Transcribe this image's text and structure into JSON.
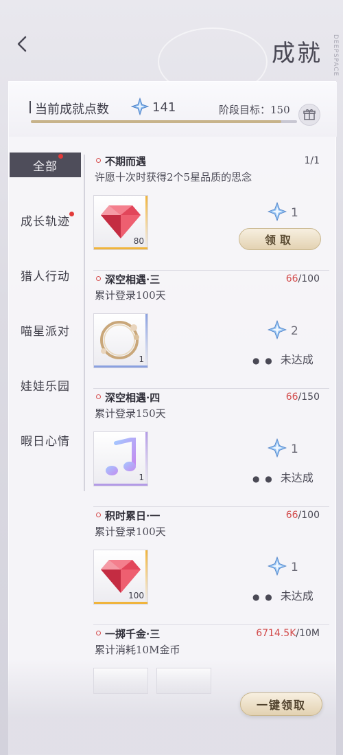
{
  "page": {
    "title": "成就"
  },
  "header": {
    "label": "当前成就点数",
    "points": "141",
    "goal": "阶段目标：150",
    "progress": 0.94
  },
  "tabs": [
    {
      "label": "全部",
      "active": true,
      "badge": true
    },
    {
      "label": "成长轨迹",
      "active": false,
      "badge": true
    },
    {
      "label": "猎人行动",
      "active": false,
      "badge": false
    },
    {
      "label": "喵星派对",
      "active": false,
      "badge": false
    },
    {
      "label": "娃娃乐园",
      "active": false,
      "badge": false
    },
    {
      "label": "暇日心情",
      "active": false,
      "badge": false
    }
  ],
  "achievements": [
    {
      "title": "不期而遇",
      "progress_current": "1",
      "progress_total": "/1",
      "completed": true,
      "desc": "许愿十次时获得2个5星品质的思念",
      "item": {
        "icon": "gem-icon",
        "count": "80",
        "color": "#f0b43c"
      },
      "reward": "1",
      "status": "领取"
    },
    {
      "title": "深空相遇·三",
      "progress_current": "66",
      "progress_total": "/100",
      "completed": false,
      "desc": "累计登录100天",
      "item": {
        "icon": "frame-icon",
        "count": "1",
        "color": "#8aa0e0"
      },
      "reward": "2",
      "status": "未达成"
    },
    {
      "title": "深空相遇·四",
      "progress_current": "66",
      "progress_total": "/150",
      "completed": false,
      "desc": "累计登录150天",
      "item": {
        "icon": "music-note-icon",
        "count": "1",
        "color": "#b39ae6"
      },
      "reward": "1",
      "status": "未达成"
    },
    {
      "title": "积时累日·一",
      "progress_current": "66",
      "progress_total": "/100",
      "completed": false,
      "desc": "累计登录100天",
      "item": {
        "icon": "gem-icon",
        "count": "100",
        "color": "#f0b43c"
      },
      "reward": "1",
      "status": "未达成"
    },
    {
      "title": "一掷千金·三",
      "progress_current": "6714.5K",
      "progress_total": "/10M",
      "completed": false,
      "desc": "累计消耗10M金币"
    }
  ],
  "footer": {
    "claim_all": "一键领取"
  },
  "colors": {
    "accent_red": "#d24a4a",
    "gold": "#c7b38a",
    "active_tab": "#4e4d5a"
  }
}
